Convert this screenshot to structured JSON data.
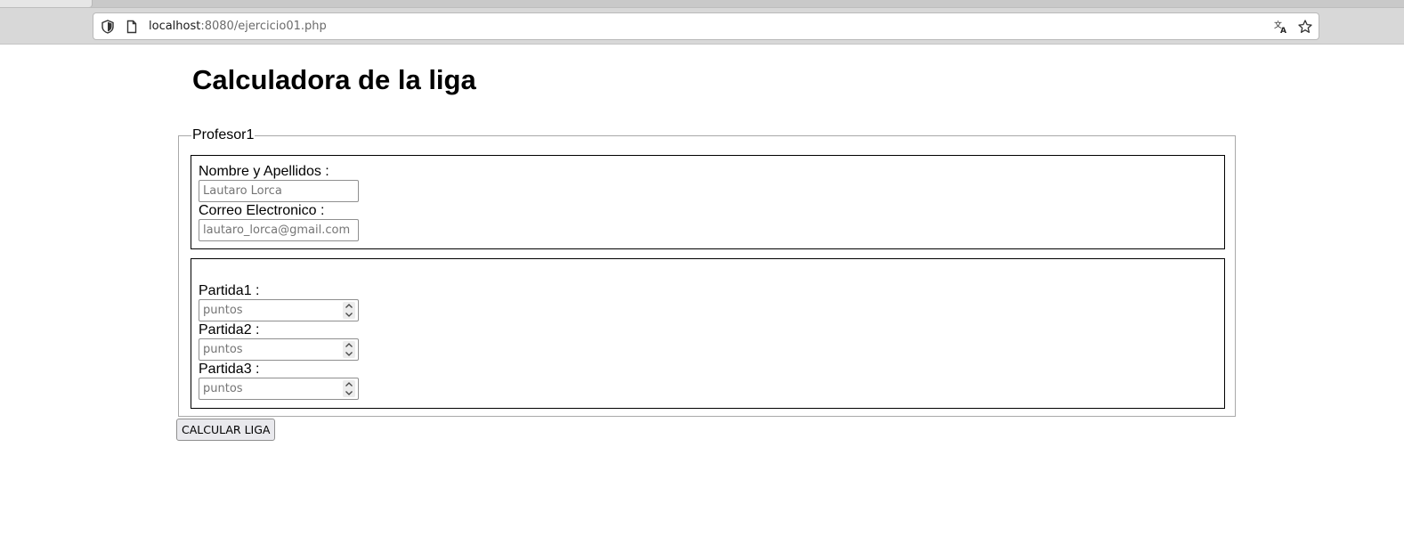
{
  "browser": {
    "url_host": "localhost",
    "url_rest": ":8080/ejercicio01.php"
  },
  "page": {
    "title": "Calculadora de la liga"
  },
  "form": {
    "legend": "Profesor1",
    "personal": {
      "name_label": "Nombre y Apellidos :",
      "name_placeholder": "Lautaro Lorca",
      "email_label": "Correo Electronico :",
      "email_placeholder": "lautaro_lorca@gmail.com"
    },
    "games": [
      {
        "label": "Partida1 :",
        "placeholder": "puntos"
      },
      {
        "label": "Partida2 :",
        "placeholder": "puntos"
      },
      {
        "label": "Partida3 :",
        "placeholder": "puntos"
      }
    ],
    "submit_label": "CALCULAR LIGA"
  }
}
